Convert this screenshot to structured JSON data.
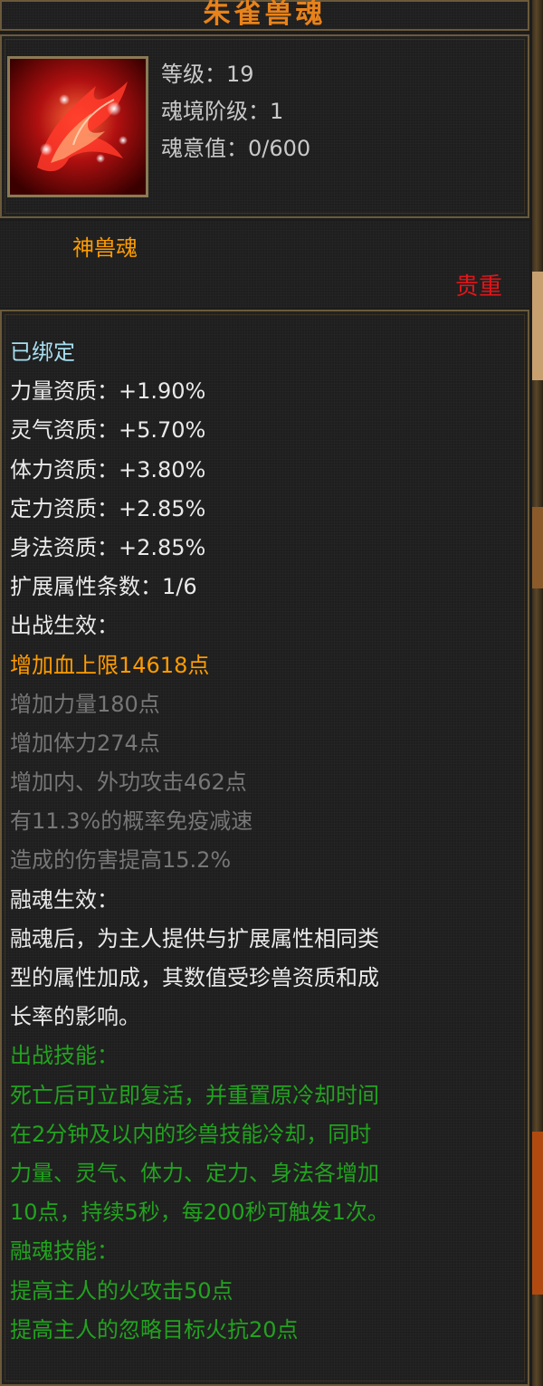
{
  "title": "朱雀兽魂",
  "header": {
    "icon": "phoenix-icon",
    "level": "等级：19",
    "realm": "魂境阶级：1",
    "soul_value": "魂意值：0/600"
  },
  "type": {
    "label": "神兽魂",
    "rarity": "贵重"
  },
  "details": {
    "bound": "已绑定",
    "attributes": [
      "力量资质：+1.90%",
      "灵气资质：+5.70%",
      "体力资质：+3.80%",
      "定力资质：+2.85%",
      "身法资质：+2.85%",
      "扩展属性条数：1/6"
    ],
    "battle_effect_header": "出战生效：",
    "battle_effects_active": [
      "增加血上限14618点"
    ],
    "battle_effects_inactive": [
      "增加力量180点",
      "增加体力274点",
      "增加内、外功攻击462点",
      "有11.3%的概率免疫减速",
      "造成的伤害提高15.2%"
    ],
    "fusion_effect_header": "融魂生效：",
    "fusion_effect_text": [
      "融魂后，为主人提供与扩展属性相同类",
      "型的属性加成，其数值受珍兽资质和成",
      "长率的影响。"
    ],
    "battle_skill_header": "出战技能：",
    "battle_skill_text": [
      "死亡后可立即复活，并重置原冷却时间",
      "在2分钟及以内的珍兽技能冷却，同时",
      "力量、灵气、体力、定力、身法各增加",
      "10点，持续5秒，每200秒可触发1次。"
    ],
    "fusion_skill_header": "融魂技能：",
    "fusion_skill_text": [
      "提高主人的火攻击50点",
      "提高主人的忽略目标火抗20点"
    ]
  },
  "colors": {
    "title": "#e8821a",
    "bound": "#a6dff0",
    "orange": "#ff9c00",
    "gray": "#777777",
    "green": "#22a31f",
    "rarity": "#e0161a"
  }
}
